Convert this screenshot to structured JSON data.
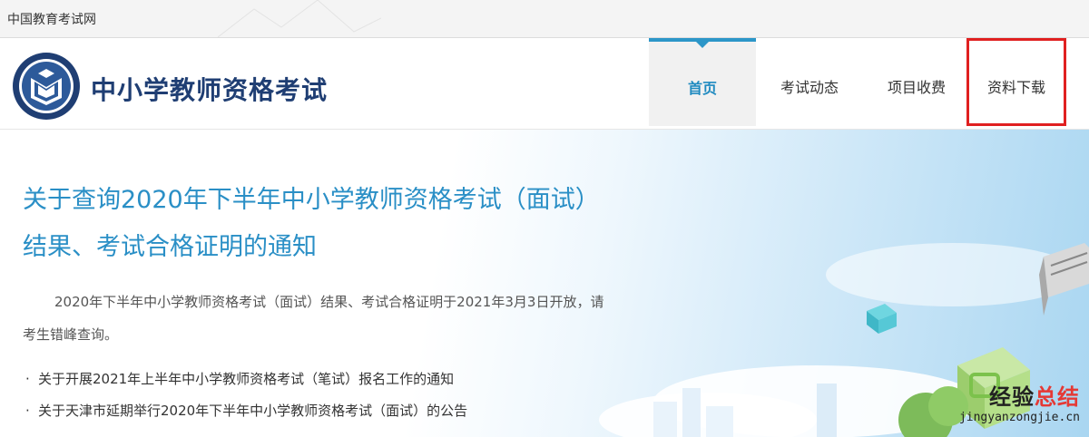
{
  "topbar": {
    "site_name": "中国教育考试网"
  },
  "header": {
    "title": "中小学教师资格考试",
    "nav": [
      {
        "label": "首页",
        "active": true
      },
      {
        "label": "考试动态",
        "active": false
      },
      {
        "label": "项目收费",
        "active": false
      },
      {
        "label": "资料下载",
        "active": false,
        "highlighted": true
      }
    ]
  },
  "hero": {
    "headline": "关于查询2020年下半年中小学教师资格考试（面试）结果、考试合格证明的通知",
    "summary": "2020年下半年中小学教师资格考试（面试）结果、考试合格证明于2021年3月3日开放，请考生错峰查询。",
    "news": [
      "关于开展2021年上半年中小学教师资格考试（笔试）报名工作的通知",
      "关于天津市延期举行2020年下半年中小学教师资格考试（面试）的公告"
    ]
  },
  "watermark": {
    "main_a": "经验",
    "main_b": "总结",
    "url": "jingyanzongjie.cn"
  },
  "colors": {
    "accent": "#2a8fc6",
    "brand": "#1f3e73",
    "highlight": "#e02020"
  }
}
